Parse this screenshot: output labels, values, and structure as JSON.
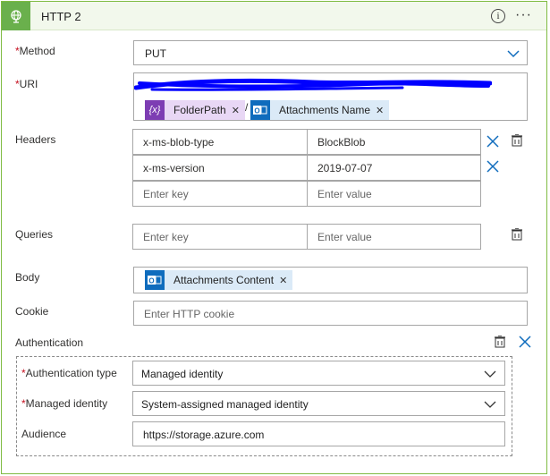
{
  "header": {
    "title": "HTTP 2",
    "info_glyph": "i",
    "more_glyph": "···",
    "icon": "globe-icon",
    "accent": "#6ab04c"
  },
  "required_mark": "*",
  "method": {
    "label": "Method",
    "value": "PUT"
  },
  "uri": {
    "label": "URI",
    "separator": "/",
    "tokens": [
      {
        "label": "FolderPath",
        "icon": "variable-icon",
        "icon_text": "{x}",
        "color": "#7d3db3",
        "bg": "#e8d7f5"
      },
      {
        "label": "Attachments Name",
        "icon": "outlook-icon",
        "color": "#0f6cbd",
        "bg": "#dbeaf7"
      }
    ],
    "redacted_color": "#0000ff"
  },
  "headers": {
    "label": "Headers",
    "rows": [
      {
        "key": "x-ms-blob-type",
        "value": "BlockBlob"
      },
      {
        "key": "x-ms-version",
        "value": "2019-07-07"
      }
    ],
    "key_placeholder": "Enter key",
    "value_placeholder": "Enter value"
  },
  "queries": {
    "label": "Queries",
    "key_placeholder": "Enter key",
    "value_placeholder": "Enter value"
  },
  "body": {
    "label": "Body",
    "token": {
      "label": "Attachments Content",
      "icon": "outlook-icon"
    }
  },
  "cookie": {
    "label": "Cookie",
    "placeholder": "Enter HTTP cookie"
  },
  "authentication": {
    "label": "Authentication",
    "type_label": "Authentication type",
    "type_value": "Managed identity",
    "identity_label": "Managed identity",
    "identity_value": "System-assigned managed identity",
    "audience_label": "Audience",
    "audience_value": "https://storage.azure.com"
  },
  "colors": {
    "required": "#c50f1f",
    "chevron": "#0f6cbd",
    "x_icon": "#0f6cbd"
  }
}
